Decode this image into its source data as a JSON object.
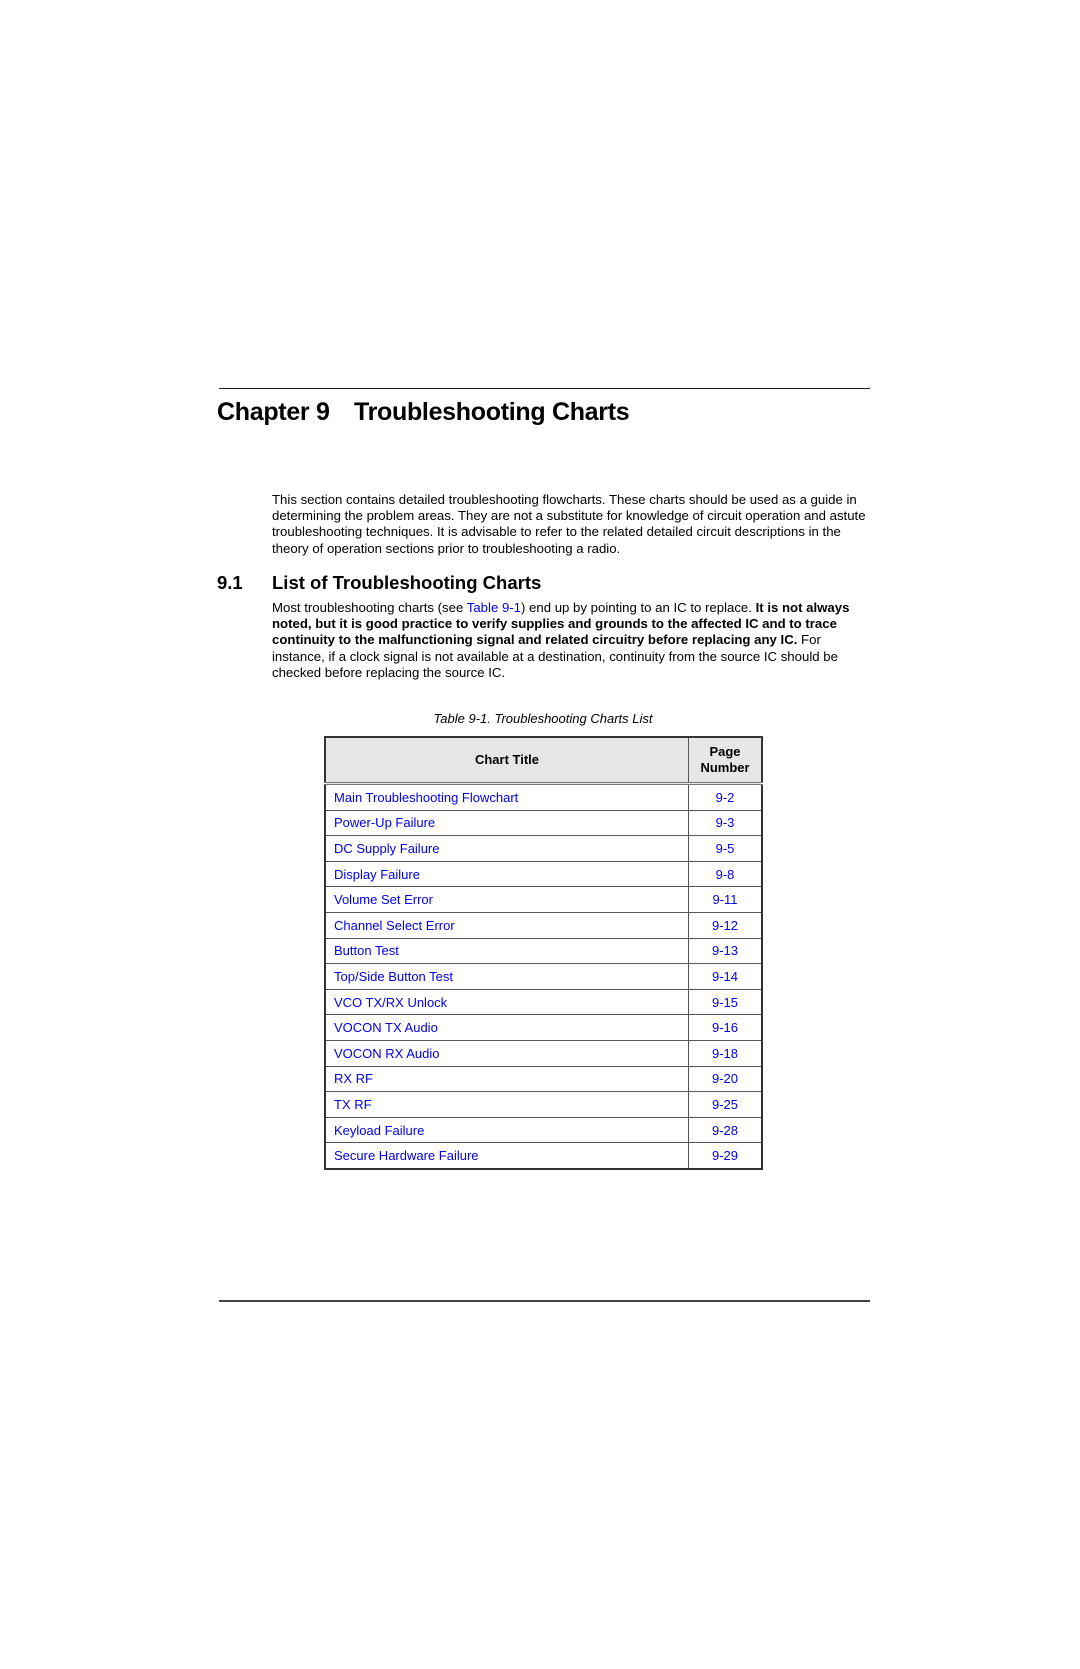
{
  "chapter": {
    "number": "Chapter 9",
    "title": "Troubleshooting Charts"
  },
  "intro": {
    "text": "This section contains detailed troubleshooting flowcharts. These charts should be used as a guide in determining the problem areas. They are not a substitute for knowledge of circuit operation and astute troubleshooting techniques. It is advisable to refer to the related detailed circuit descriptions in the theory of operation sections prior to troubleshooting a radio."
  },
  "section": {
    "number": "9.1",
    "title": "List of Troubleshooting Charts",
    "para_before_link": "Most troubleshooting charts (see ",
    "link_text": "Table 9-1",
    "para_after_link": ") end up by pointing to an IC to replace. ",
    "para_bold": "It is not always noted, but it is good practice to verify supplies and grounds to the affected IC and to trace continuity to the malfunctioning signal and related circuitry before replacing any IC.",
    "para_end": " For instance, if a clock signal is not available at a destination, continuity from the source IC should be checked before replacing the source IC."
  },
  "table": {
    "caption": "Table 9-1.  Troubleshooting Charts List",
    "headers": {
      "title": "Chart Title",
      "page_line1": "Page",
      "page_line2": "Number"
    },
    "rows": [
      {
        "title": "Main Troubleshooting Flowchart",
        "page": "9-2"
      },
      {
        "title": "Power-Up Failure",
        "page": "9-3"
      },
      {
        "title": "DC Supply Failure",
        "page": "9-5"
      },
      {
        "title": "Display Failure",
        "page": "9-8"
      },
      {
        "title": "Volume Set Error",
        "page": "9-11"
      },
      {
        "title": "Channel Select Error",
        "page": "9-12"
      },
      {
        "title": "Button Test",
        "page": "9-13"
      },
      {
        "title": "Top/Side Button Test",
        "page": "9-14"
      },
      {
        "title": "VCO TX/RX Unlock",
        "page": "9-15"
      },
      {
        "title": "VOCON TX Audio",
        "page": "9-16"
      },
      {
        "title": "VOCON RX Audio",
        "page": "9-18"
      },
      {
        "title": "RX RF",
        "page": "9-20"
      },
      {
        "title": "TX RF",
        "page": "9-25"
      },
      {
        "title": "Keyload Failure",
        "page": "9-28"
      },
      {
        "title": "Secure Hardware Failure",
        "page": "9-29"
      }
    ]
  },
  "colors": {
    "link": "#0000ee",
    "header_bg": "#e6e6e6"
  }
}
